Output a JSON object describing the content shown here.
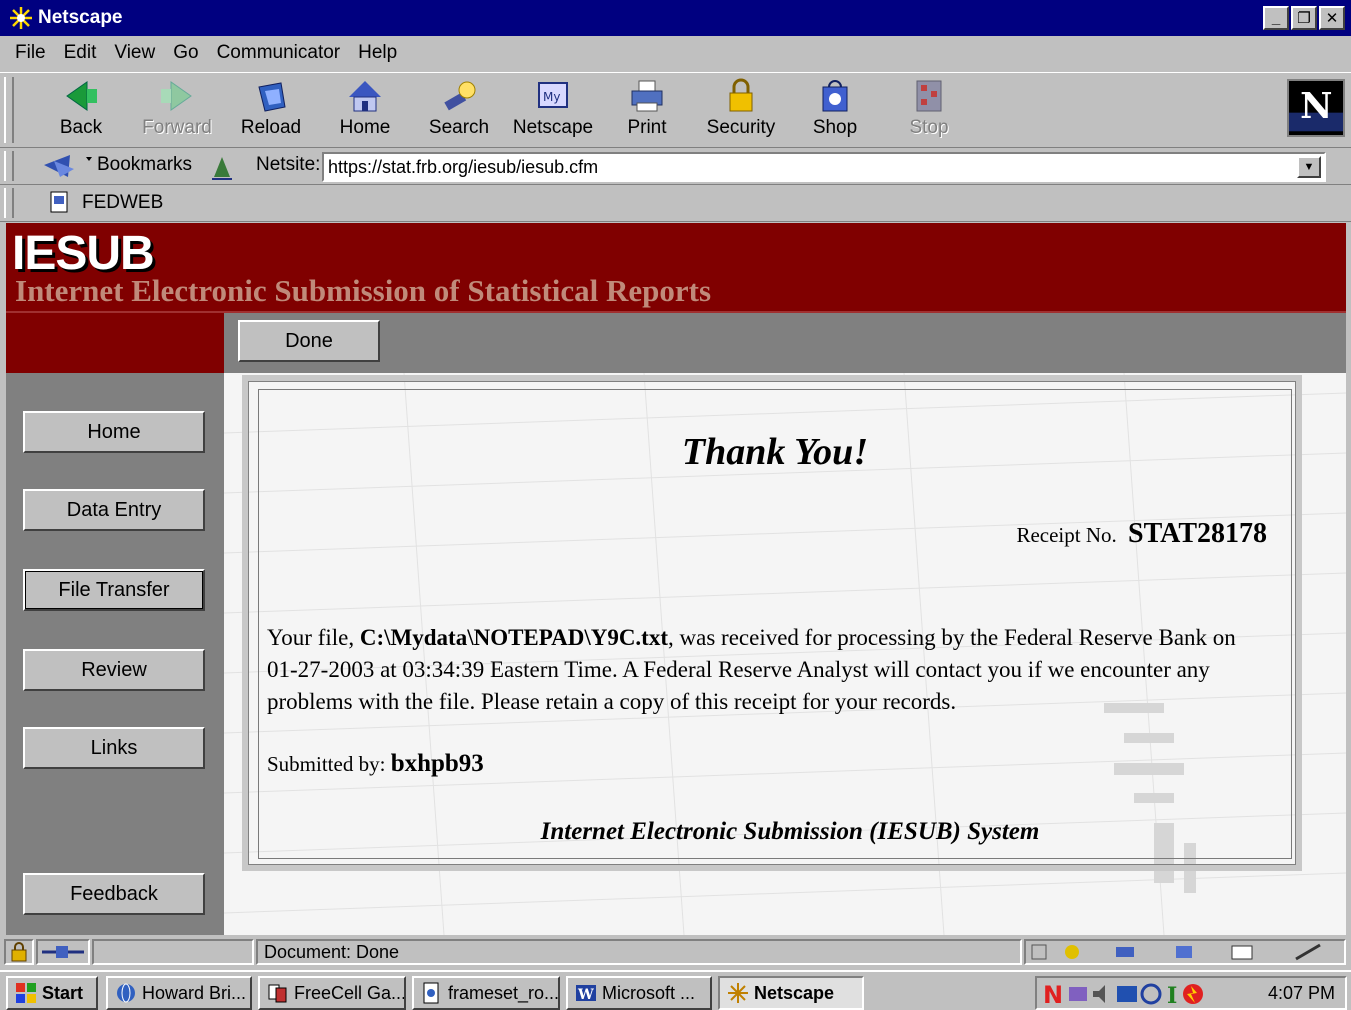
{
  "window": {
    "title": "Netscape"
  },
  "menu": [
    "File",
    "Edit",
    "View",
    "Go",
    "Communicator",
    "Help"
  ],
  "nav_buttons": [
    {
      "label": "Back",
      "enabled": true
    },
    {
      "label": "Forward",
      "enabled": false
    },
    {
      "label": "Reload",
      "enabled": true
    },
    {
      "label": "Home",
      "enabled": true
    },
    {
      "label": "Search",
      "enabled": true
    },
    {
      "label": "Netscape",
      "enabled": true
    },
    {
      "label": "Print",
      "enabled": true
    },
    {
      "label": "Security",
      "enabled": true
    },
    {
      "label": "Shop",
      "enabled": true
    },
    {
      "label": "Stop",
      "enabled": false
    }
  ],
  "location": {
    "bookmarks_label": "Bookmarks",
    "field_label": "Netsite:",
    "url": "https://stat.frb.org/iesub/iesub.cfm"
  },
  "personal_toolbar": {
    "item": "FEDWEB"
  },
  "page": {
    "logo": "IESUB",
    "subtitle": "Internet Electronic Submission of Statistical Reports",
    "done_button": "Done",
    "left_nav": [
      "Home",
      "Data Entry",
      "File Transfer",
      "Review",
      "Links",
      "Feedback"
    ],
    "thanks": "Thank You!",
    "receipt_label": "Receipt No.",
    "receipt_no": "STAT28178",
    "msg_pre": "Your file, ",
    "msg_file": "C:\\Mydata\\NOTEPAD\\Y9C.txt",
    "msg_post": ", was received for processing by the Federal Reserve Bank on 01-27-2003 at 03:34:39 Eastern Time. A Federal Reserve Analyst will contact you if we encounter any problems with the file. Please retain a copy of this receipt for your records.",
    "submitted_label": "Submitted by:",
    "submitted_user": "bxhpb93",
    "system_name": "Internet Electronic Submission (IESUB) System"
  },
  "status": {
    "text": "Document: Done"
  },
  "taskbar": {
    "start": "Start",
    "tasks": [
      "Howard Bri...",
      "FreeCell Ga...",
      "frameset_ro...",
      "Microsoft ...",
      "Netscape"
    ],
    "clock": "4:07 PM"
  },
  "colors": {
    "header_red": "#800000",
    "titlebar": "#000080",
    "subtitle": "#c08a7a"
  }
}
